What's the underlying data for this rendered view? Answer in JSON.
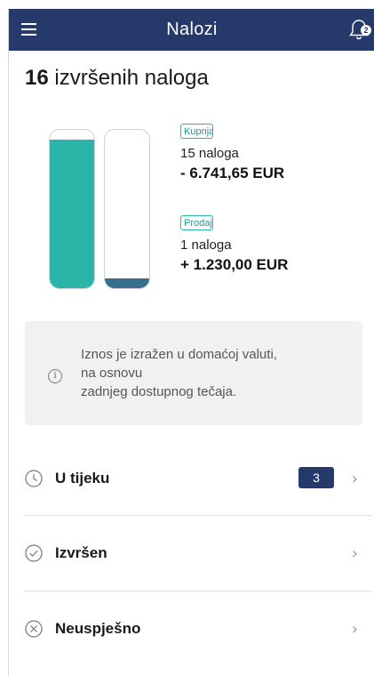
{
  "header": {
    "title": "Nalozi",
    "menu_icon": "hamburger-menu-icon",
    "notification_icon": "bell-icon",
    "notification_count": "2",
    "color": "#253a6b"
  },
  "summary": {
    "count": "16",
    "label": "izvršenih naloga"
  },
  "chart": {
    "buy": {
      "tag": "Kupnja",
      "count_text": "15 naloga",
      "amount": "- 6.741,65 EUR",
      "fill_fraction": 0.9375,
      "color": "#2bb5a8"
    },
    "sell": {
      "tag": "Prodaja",
      "count_text": "1 naloga",
      "amount": "+ 1.230,00 EUR",
      "fill_fraction": 0.0625,
      "color": "#3a6f8c"
    }
  },
  "info": {
    "icon": "info-circle-icon",
    "text": "Iznos je izražen u domaćoj valuti,\nna osnovu\nzadnjeg dostupnog tečaja."
  },
  "status_list": [
    {
      "label": "U tijeku",
      "icon": "clock-icon",
      "badge": "3"
    },
    {
      "label": "Izvršen",
      "icon": "check-circle-icon",
      "badge": ""
    },
    {
      "label": "Neuspješno",
      "icon": "x-circle-icon",
      "badge": ""
    }
  ]
}
